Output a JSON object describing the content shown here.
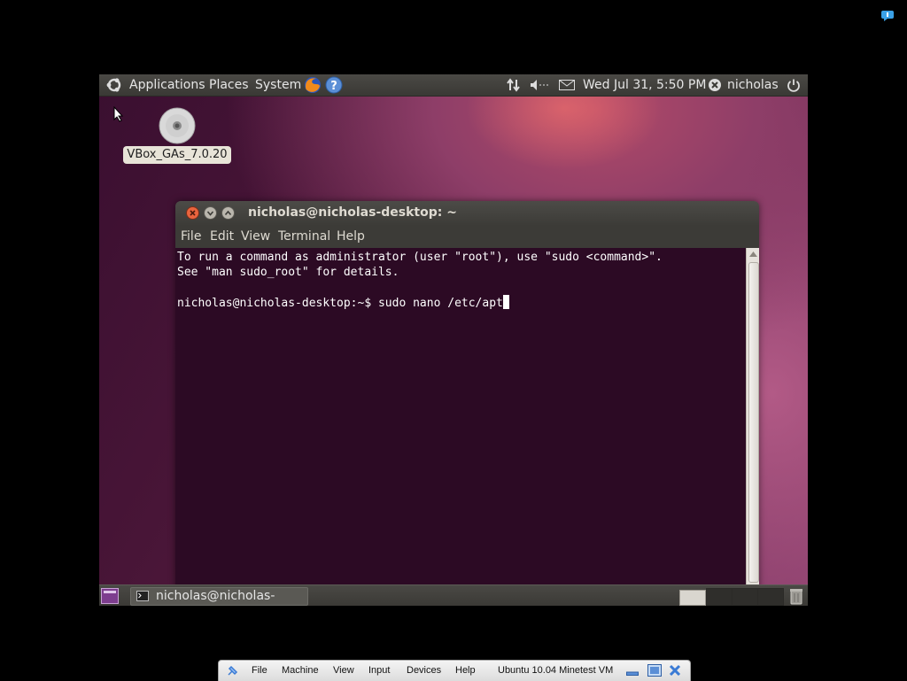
{
  "host": {
    "corner_icon": "speech-bubble-icon"
  },
  "top_panel": {
    "menus": [
      "Applications",
      "Places",
      "System"
    ],
    "datetime": "Wed Jul 31,  5:50 PM",
    "user": "nicholas"
  },
  "desktop": {
    "icon_label": "VBox_GAs_7.0.20"
  },
  "terminal": {
    "title": "nicholas@nicholas-desktop: ~",
    "menu": [
      "File",
      "Edit",
      "View",
      "Terminal",
      "Help"
    ],
    "lines": [
      "To run a command as administrator (user \"root\"), use \"sudo <command>\".",
      "See \"man sudo_root\" for details.",
      "",
      "nicholas@nicholas-desktop:~$ sudo nano /etc/apt"
    ]
  },
  "bottom_panel": {
    "task_label": "nicholas@nicholas-des..."
  },
  "vbox_toolbar": {
    "menus": [
      "File",
      "Machine",
      "View",
      "Input",
      "Devices",
      "Help"
    ],
    "vm_name": "Ubuntu 10.04 Minetest VM"
  }
}
